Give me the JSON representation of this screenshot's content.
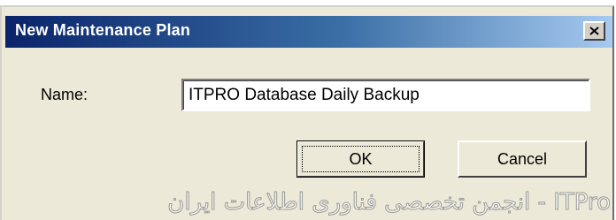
{
  "dialog": {
    "title": "New Maintenance Plan",
    "close_glyph": "x"
  },
  "form": {
    "name_label": "Name:",
    "name_value": "ITPRO Database Daily Backup"
  },
  "buttons": {
    "ok_label": "OK",
    "cancel_label": "Cancel"
  },
  "watermark": {
    "text": "ITPro - انجمن تخصصی فناوری اطلاعات ایران"
  },
  "colors": {
    "titlebar_start": "#0a246a",
    "titlebar_end": "#a6caf0",
    "dialog_bg": "#ece9d8"
  },
  "icons": {
    "close": "close-icon"
  }
}
